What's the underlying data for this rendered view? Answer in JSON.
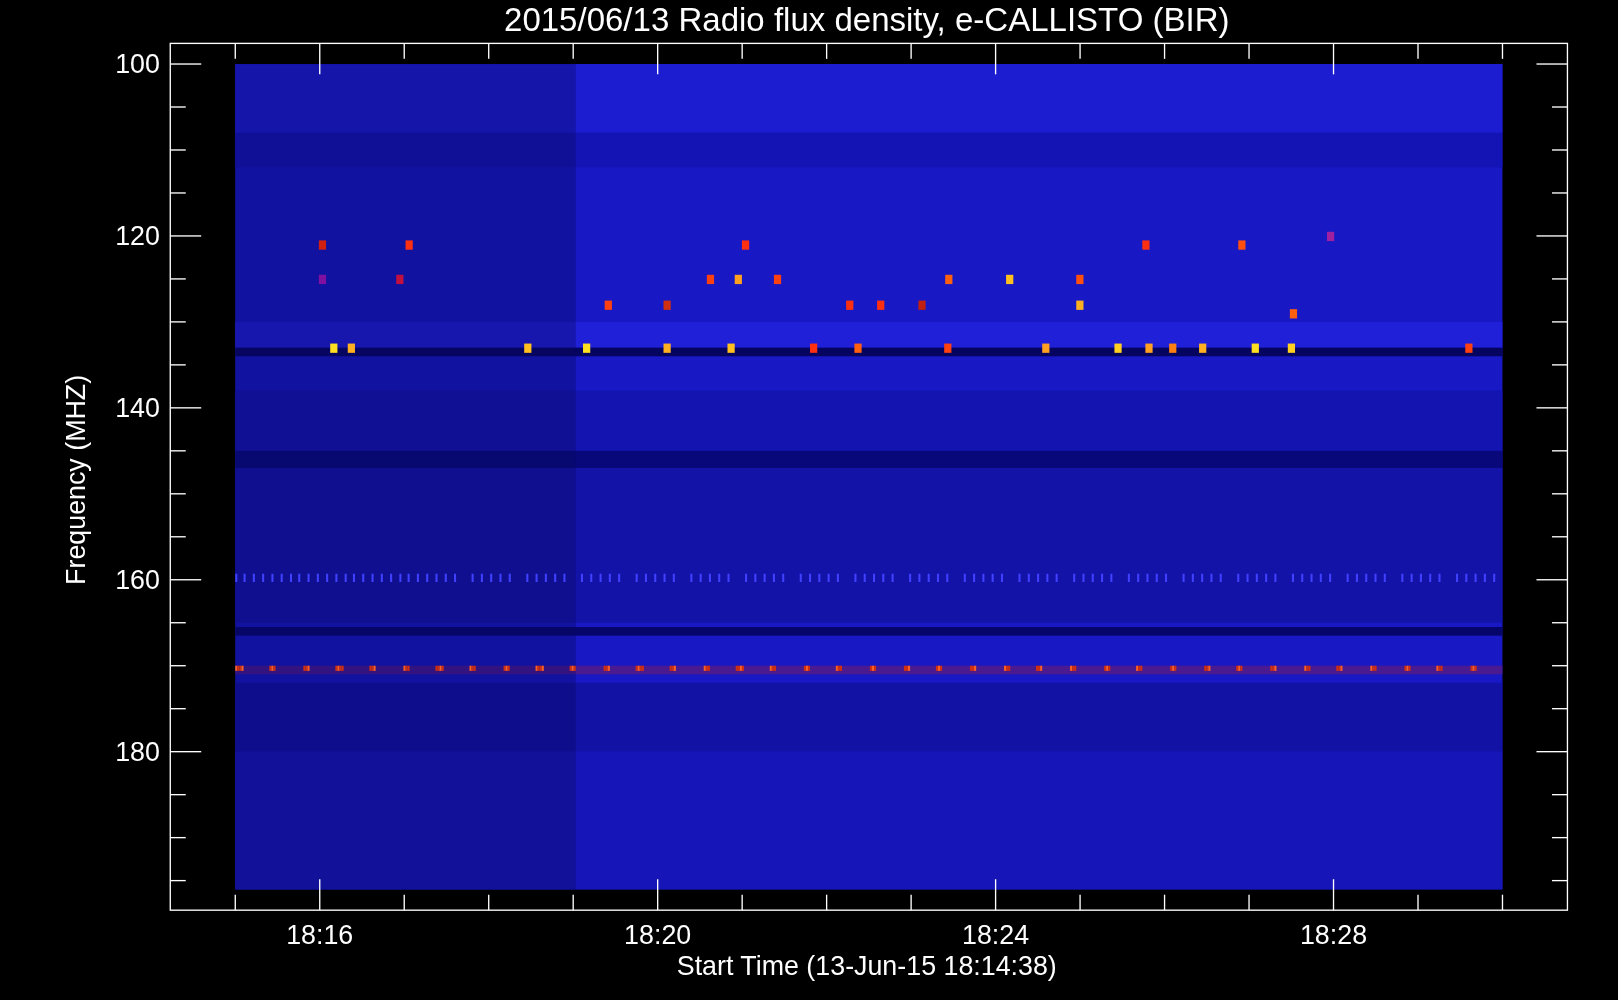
{
  "plot": {
    "title": "2015/06/13  Radio flux density, e-CALLISTO (BIR)",
    "ylabel": "Frequency (MHZ)",
    "xlabel": "Start Time (13-Jun-15 18:14:38)",
    "y_tick_labels": [
      "100",
      "120",
      "140",
      "160",
      "180"
    ],
    "x_tick_labels": [
      "18:16",
      "18:20",
      "18:24",
      "18:28"
    ]
  }
}
